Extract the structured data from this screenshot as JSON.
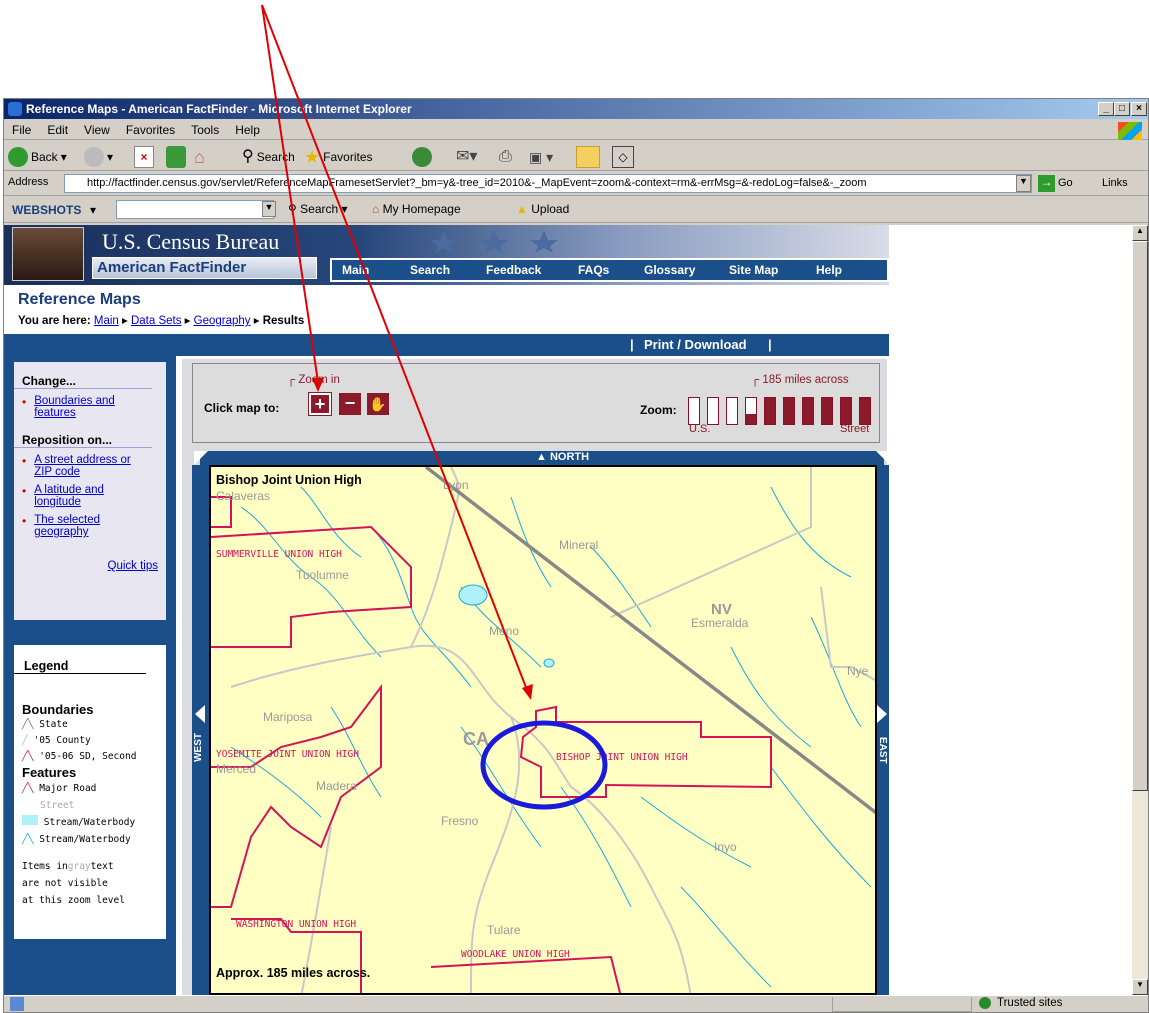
{
  "window": {
    "title": "Reference Maps - American FactFinder - Microsoft Internet Explorer",
    "controls": {
      "minimize": "_",
      "maximize": "□",
      "close": "×"
    }
  },
  "menu": [
    "File",
    "Edit",
    "View",
    "Favorites",
    "Tools",
    "Help"
  ],
  "toolbar": {
    "back": "Back",
    "search": "Search",
    "favorites": "Favorites"
  },
  "address": {
    "label": "Address",
    "url": "http://factfinder.census.gov/servlet/ReferenceMapFramesetServlet?_bm=y&-tree_id=2010&-_MapEvent=zoom&-context=rm&-errMsg=&-redoLog=false&-_zoom",
    "go": "Go",
    "links": "Links"
  },
  "webshots": {
    "brand": "WEBSHOTS",
    "search": "Search",
    "homepage": "My Homepage",
    "upload": "Upload"
  },
  "site": {
    "bureau": "U.S. Census Bureau",
    "factfinder": "American FactFinder",
    "nav": [
      "Main",
      "Search",
      "Feedback",
      "FAQs",
      "Glossary",
      "Site Map",
      "Help"
    ],
    "page_title": "Reference Maps",
    "breadcrumb": {
      "label": "You are here:",
      "items": [
        "Main",
        "Data Sets",
        "Geography"
      ],
      "current": "Results"
    },
    "print_download": "Print / Download"
  },
  "sidebar": {
    "change_heading": "Change...",
    "change_links": [
      "Boundaries and features"
    ],
    "reposition_heading": "Reposition on...",
    "reposition_links": [
      "A street address or ZIP code",
      "A latitude and longitude",
      "The selected geography"
    ],
    "quick_tips": "Quick tips"
  },
  "legend": {
    "heading": "Legend",
    "boundaries_heading": "Boundaries",
    "boundaries": [
      "State",
      "'05 County",
      "'05-06 SD, Second"
    ],
    "features_heading": "Features",
    "features": [
      "Major Road",
      "Street",
      "Stream/Waterbody",
      "Stream/Waterbody"
    ],
    "note_lines": [
      "Items in",
      "gray",
      "text",
      "are not visible",
      "at this zoom level"
    ]
  },
  "map_controls": {
    "click_label": "Click map to:",
    "zoom_in_caption": "Zoom in",
    "zoom_label": "Zoom:",
    "scale_caption": "185 miles across",
    "zoom_min": "U.S.",
    "zoom_max": "Street",
    "zoom_level": 4,
    "zoom_levels": 10
  },
  "map": {
    "north": "NORTH",
    "west": "WEST",
    "east": "EAST",
    "title": "Bishop Joint Union High",
    "scale_note": "Approx. 185 miles across.",
    "labels": {
      "calaveras": "Calaveras",
      "lyon": "Lyon",
      "summerville": "SUMMERVILLE UNION HIGH",
      "mineral": "Mineral",
      "tuolumne": "Tuolumne",
      "nv": "NV",
      "esmeralda": "Esmeralda",
      "mono": "Mono",
      "nye": "Nye",
      "mariposa": "Mariposa",
      "ca": "CA",
      "yosemite": "YOSEMITE JOINT UNION HIGH",
      "bishop": "BISHOP JOINT UNION HIGH",
      "merced": "Merced",
      "madera": "Madera",
      "fresno": "Fresno",
      "inyo": "Inyo",
      "washington": "WASHINGTON UNION HIGH",
      "tulare": "Tulare",
      "woodlake": "WOODLAKE UNION HIGH"
    }
  },
  "status": {
    "zone": "Trusted sites"
  },
  "colors": {
    "accent": "#1b4f8a",
    "boundary": "#d4145a",
    "annotation": "#e00000",
    "highlight": "#1a1adc",
    "map_bg": "#ffffc4"
  }
}
